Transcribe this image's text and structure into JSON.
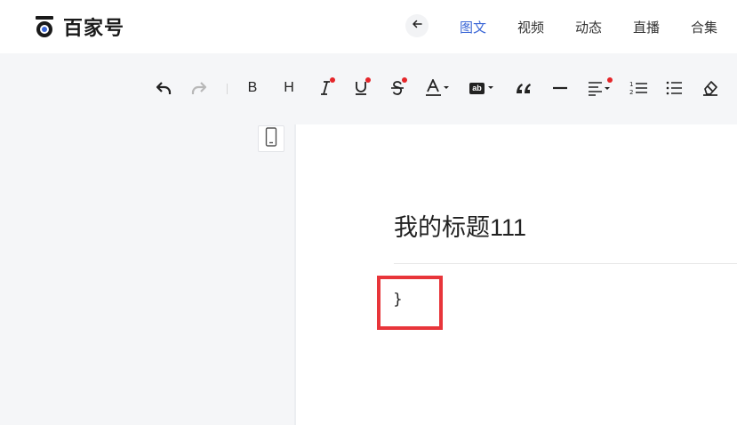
{
  "header": {
    "logo_text": "百家号",
    "back_icon": "arrow-left-icon",
    "nav": [
      {
        "label": "图文",
        "active": true
      },
      {
        "label": "视频",
        "active": false
      },
      {
        "label": "动态",
        "active": false
      },
      {
        "label": "直播",
        "active": false
      },
      {
        "label": "合集",
        "active": false
      }
    ]
  },
  "toolbar": {
    "tools": [
      "undo-icon",
      "redo-icon",
      "bold",
      "heading",
      "italic-icon",
      "underline-icon",
      "strikethrough-icon",
      "font-color-icon",
      "highlight-icon",
      "quote-icon",
      "divider-icon",
      "align-icon",
      "ordered-list-icon",
      "bullet-list-icon",
      "clear-format-icon"
    ],
    "bold_label": "B",
    "heading_label": "H",
    "highlight_label": "ab"
  },
  "editor": {
    "device_icon": "mobile-preview-icon",
    "title": "我的标题111",
    "body": "}"
  },
  "colors": {
    "accent": "#3a66d6",
    "badge": "#e5262a",
    "annotation": "#e8353a"
  }
}
